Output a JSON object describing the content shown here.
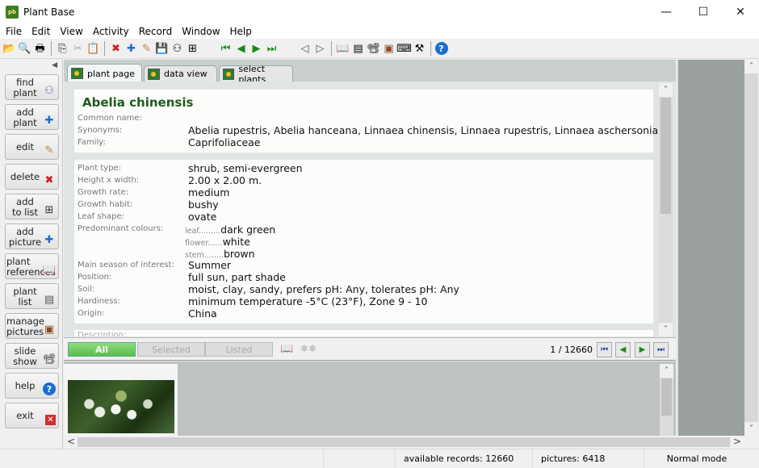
{
  "window": {
    "title": "Plant Base",
    "app_icon_text": "pb",
    "controls": {
      "minimize": "—",
      "maximize": "☐",
      "close": "✕"
    }
  },
  "menu": [
    "File",
    "Edit",
    "View",
    "Activity",
    "Record",
    "Window",
    "Help"
  ],
  "toolbar": {
    "groups": [
      [
        {
          "icon": "open-folder-icon",
          "glyph": "📂"
        },
        {
          "icon": "print-preview-icon",
          "glyph": "🔍"
        },
        {
          "icon": "print-icon",
          "glyph": "🖶"
        }
      ],
      [
        {
          "icon": "copy-icon",
          "glyph": "⎘"
        },
        {
          "icon": "cut-icon",
          "glyph": "✂"
        },
        {
          "icon": "paste-icon",
          "glyph": "📋"
        }
      ],
      [
        {
          "icon": "delete-icon",
          "glyph": "✖"
        },
        {
          "icon": "add-icon",
          "glyph": "✚"
        },
        {
          "icon": "edit-pencil-icon",
          "glyph": "✎"
        },
        {
          "icon": "save-icon",
          "glyph": "💾"
        },
        {
          "icon": "find-binoculars-icon",
          "glyph": "⚇"
        },
        {
          "icon": "add-to-list-icon",
          "glyph": "⊞"
        }
      ],
      [
        {
          "icon": "first-record-icon",
          "glyph": "⏮"
        },
        {
          "icon": "previous-record-icon",
          "glyph": "◀"
        },
        {
          "icon": "next-record-icon",
          "glyph": "▶"
        },
        {
          "icon": "last-record-icon",
          "glyph": "⏭"
        }
      ],
      [
        {
          "icon": "back-icon",
          "glyph": "◁"
        },
        {
          "icon": "forward-icon",
          "glyph": "▷"
        }
      ],
      [
        {
          "icon": "references-book-icon",
          "glyph": "📖"
        },
        {
          "icon": "plant-list-icon",
          "glyph": "▤"
        },
        {
          "icon": "slide-show-projector-icon",
          "glyph": "📽"
        },
        {
          "icon": "manage-pictures-icon",
          "glyph": "▣"
        },
        {
          "icon": "keyboard-icon",
          "glyph": "⌨"
        },
        {
          "icon": "tools-icon",
          "glyph": "⚒"
        }
      ],
      [
        {
          "icon": "help-icon",
          "glyph": "?"
        }
      ]
    ]
  },
  "sidebar": {
    "collapse_glyph": "◀",
    "buttons": [
      {
        "label": "find\nplant",
        "icon": "binoculars-icon",
        "glyph": "⚇",
        "color": "#5577aa"
      },
      {
        "label": "add\nplant",
        "icon": "add-plant-icon",
        "glyph": "✚",
        "color": "#1a6fd0"
      },
      {
        "label": "edit",
        "icon": "pencil-icon",
        "glyph": "✎",
        "color": "#b08840"
      },
      {
        "label": "delete",
        "icon": "delete-x-icon",
        "glyph": "✖",
        "color": "#d02020"
      },
      {
        "label": "add\nto list",
        "icon": "add-to-list-icon",
        "glyph": "⊞",
        "color": "#333333"
      },
      {
        "label": "add\npicture",
        "icon": "add-picture-icon",
        "glyph": "✚",
        "color": "#1a6fd0"
      },
      {
        "label": "plant\nreferences",
        "icon": "book-icon",
        "glyph": "📖",
        "color": "#3a6ea8"
      },
      {
        "label": "plant\nlist",
        "icon": "list-icon",
        "glyph": "▤",
        "color": "#555555"
      },
      {
        "label": "manage\npictures",
        "icon": "pictures-icon",
        "glyph": "▣",
        "color": "#8a4a20"
      },
      {
        "label": "slide\nshow",
        "icon": "projector-icon",
        "glyph": "📽",
        "color": "#333333"
      },
      {
        "label": "help",
        "icon": "help-icon",
        "glyph": "?",
        "color": "#1a6fd0"
      },
      {
        "label": "exit",
        "icon": "exit-icon",
        "glyph": "✕",
        "color": "#d03030"
      }
    ]
  },
  "tabs": [
    {
      "label": "plant page",
      "active": true
    },
    {
      "label": "data view",
      "active": false
    },
    {
      "label": "select plants",
      "active": false
    }
  ],
  "plant": {
    "name": "Abelia chinensis",
    "header_fields": [
      {
        "label": "Common name:",
        "value": ""
      },
      {
        "label": "Synonyms:",
        "value": "Abelia rupestris, Abelia hanceana, Linnaea chinensis, Linnaea rupestris, Linnaea aschersoniana"
      },
      {
        "label": "Family:",
        "value": "Caprifoliaceae"
      }
    ],
    "fields": [
      {
        "label": "Plant type:",
        "value": "shrub, semi-evergreen"
      },
      {
        "label": "Height x width:",
        "value": "2.00 x 2.00 m."
      },
      {
        "label": "Growth rate:",
        "value": "medium"
      },
      {
        "label": "Growth habit:",
        "value": "bushy"
      },
      {
        "label": "Leaf shape:",
        "value": "ovate"
      },
      {
        "label": "Predominant colours:",
        "value": ""
      }
    ],
    "colours": [
      {
        "part": "leaf.........",
        "value": "dark green"
      },
      {
        "part": "flower......",
        "value": "white"
      },
      {
        "part": "stem........",
        "value": "brown"
      }
    ],
    "fields2": [
      {
        "label": "Main season of interest:",
        "value": "Summer"
      },
      {
        "label": "Position:",
        "value": "full sun, part shade"
      },
      {
        "label": "Soil:",
        "value": "moist, clay, sandy, prefers pH: Any, tolerates pH: Any"
      },
      {
        "label": "Hardiness:",
        "value": "minimum temperature -5°C (23°F), Zone 9 - 10"
      },
      {
        "label": "Origin:",
        "value": "China"
      }
    ],
    "description_label": "Description:"
  },
  "filter": {
    "all": "All",
    "selected": "Selected",
    "listed": "Listed",
    "book_glyph": "📖",
    "snow_glyph": "❄❄"
  },
  "navigation": {
    "current": 1,
    "total": 12660,
    "display": "1 / 12660",
    "first": "⏮",
    "prev": "◀",
    "next": "▶",
    "last": "⏭"
  },
  "scroll": {
    "up": "˄",
    "down": "˅",
    "left": "<",
    "right": ">"
  },
  "status": {
    "available_records": "available records: 12660",
    "pictures": "pictures: 6418",
    "mode": "Normal mode"
  }
}
